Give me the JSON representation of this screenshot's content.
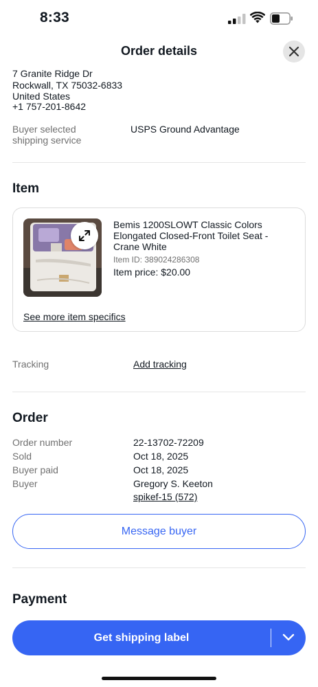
{
  "status_bar": {
    "time": "8:33"
  },
  "header": {
    "title": "Order details"
  },
  "address": {
    "street": "7 Granite Ridge Dr",
    "city_line": "Rockwall, TX 75032-6833",
    "country": "United States",
    "phone": "+1 757-201-8642"
  },
  "shipping": {
    "label_line1": "Buyer selected",
    "label_line2": "shipping service",
    "value": "USPS Ground Advantage"
  },
  "item_section": {
    "title": "Item",
    "item_title": "Bemis 1200SLOWT Classic Colors Elongated Closed-Front Toilet Seat - Crane White",
    "item_id": "Item ID: 389024286308",
    "item_price": "Item price: $20.00",
    "see_more": "See more item specifics"
  },
  "tracking": {
    "label": "Tracking",
    "link": "Add tracking"
  },
  "order_section": {
    "title": "Order",
    "rows": [
      {
        "label": "Order number",
        "value": "22-13702-72209"
      },
      {
        "label": "Sold",
        "value": "Oct 18, 2025"
      },
      {
        "label": "Buyer paid",
        "value": "Oct 18, 2025"
      },
      {
        "label": "Buyer",
        "value": "Gregory S. Keeton"
      }
    ],
    "buyer_username": "spikef-15 (572)",
    "message_button": "Message buyer"
  },
  "payment_section": {
    "title": "Payment"
  },
  "bottom_bar": {
    "primary_label": "Get shipping label"
  },
  "colors": {
    "accent": "#3665f3",
    "text": "#111820",
    "secondary_text": "#707070"
  }
}
